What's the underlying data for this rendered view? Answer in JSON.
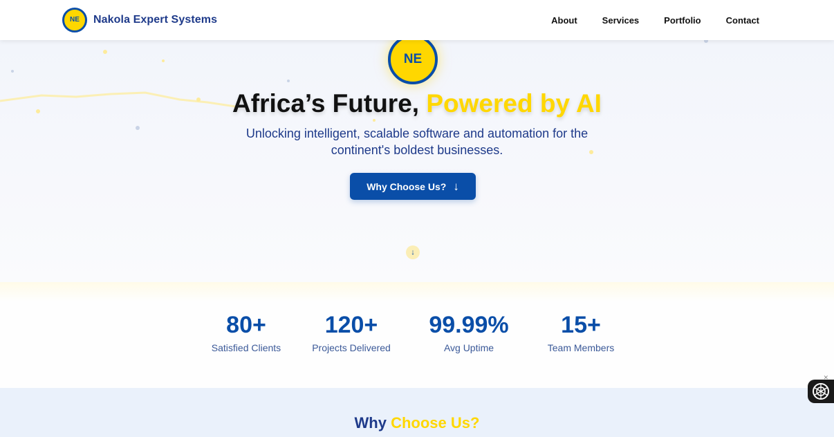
{
  "nav": {
    "logo_text": "NE",
    "brand_name": "Nakola Expert Systems",
    "links": [
      "About",
      "Services",
      "Portfolio",
      "Contact"
    ]
  },
  "hero": {
    "logo_text": "NE",
    "title_main": "Africa’s Future, ",
    "title_accent": "Powered by AI",
    "subtitle": "Unlocking intelligent, scalable software and automation for the continent's boldest businesses.",
    "cta_label": "Why Choose Us?",
    "cta_icon": "arrow-down-icon",
    "scroll_icon": "arrow-down-icon"
  },
  "stats": [
    {
      "value": "80+",
      "label": "Satisfied Clients"
    },
    {
      "value": "120+",
      "label": "Projects Delivered"
    },
    {
      "value": "99.99%",
      "label": "Avg Uptime"
    },
    {
      "value": "15+",
      "label": "Team Members"
    }
  ],
  "why": {
    "title_main": "Why ",
    "title_accent": "Choose Us?"
  },
  "widget": {
    "icon": "chatbot-icon",
    "close_icon": "close-icon"
  },
  "colors": {
    "primary": "#0a4ea8",
    "accent": "#ffd700",
    "navy": "#1e3a8a"
  }
}
